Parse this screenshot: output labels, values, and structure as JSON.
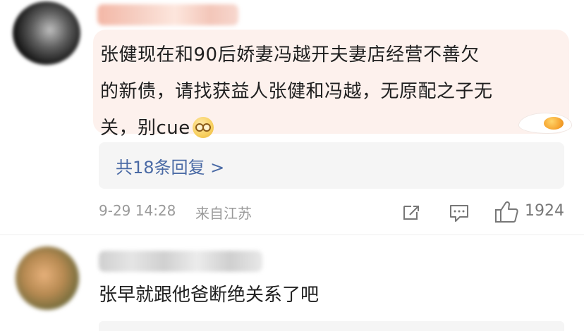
{
  "comments": [
    {
      "text_line1": "张健现在和90后娇妻冯越开夫妻店经营不善欠",
      "text_line2": "的新债，请找获益人张健和冯越，无原配之子无",
      "text_line3": "关，别cue",
      "emoji": "hands-over-eyes-emoji",
      "replies_label": "共18条回复 >",
      "time": "9-29 14:28",
      "location": "来自江苏",
      "likes": "1924"
    },
    {
      "text": "张早就跟他爸断绝关系了吧"
    }
  ],
  "icons": {
    "share": "share-icon",
    "comment": "comment-icon",
    "like": "thumbs-up-icon"
  },
  "colors": {
    "bubble_bg": "#fdf1ed",
    "link": "#4a6aa5",
    "meta": "#999999"
  }
}
